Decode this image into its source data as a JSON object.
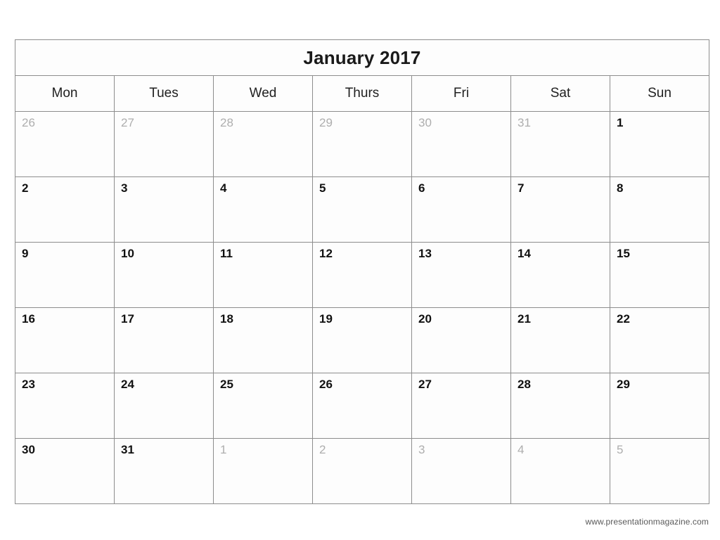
{
  "calendar": {
    "title": "January 2017",
    "weekdays": [
      "Mon",
      "Tues",
      "Wed",
      "Thurs",
      "Fri",
      "Sat",
      "Sun"
    ],
    "weeks": [
      [
        {
          "day": "26",
          "muted": true
        },
        {
          "day": "27",
          "muted": true
        },
        {
          "day": "28",
          "muted": true
        },
        {
          "day": "29",
          "muted": true
        },
        {
          "day": "30",
          "muted": true
        },
        {
          "day": "31",
          "muted": true
        },
        {
          "day": "1",
          "muted": false
        }
      ],
      [
        {
          "day": "2",
          "muted": false
        },
        {
          "day": "3",
          "muted": false
        },
        {
          "day": "4",
          "muted": false
        },
        {
          "day": "5",
          "muted": false
        },
        {
          "day": "6",
          "muted": false
        },
        {
          "day": "7",
          "muted": false
        },
        {
          "day": "8",
          "muted": false
        }
      ],
      [
        {
          "day": "9",
          "muted": false
        },
        {
          "day": "10",
          "muted": false
        },
        {
          "day": "11",
          "muted": false
        },
        {
          "day": "12",
          "muted": false
        },
        {
          "day": "13",
          "muted": false
        },
        {
          "day": "14",
          "muted": false
        },
        {
          "day": "15",
          "muted": false
        }
      ],
      [
        {
          "day": "16",
          "muted": false
        },
        {
          "day": "17",
          "muted": false
        },
        {
          "day": "18",
          "muted": false
        },
        {
          "day": "19",
          "muted": false
        },
        {
          "day": "20",
          "muted": false
        },
        {
          "day": "21",
          "muted": false
        },
        {
          "day": "22",
          "muted": false
        }
      ],
      [
        {
          "day": "23",
          "muted": false
        },
        {
          "day": "24",
          "muted": false
        },
        {
          "day": "25",
          "muted": false
        },
        {
          "day": "26",
          "muted": false
        },
        {
          "day": "27",
          "muted": false
        },
        {
          "day": "28",
          "muted": false
        },
        {
          "day": "29",
          "muted": false
        }
      ],
      [
        {
          "day": "30",
          "muted": false
        },
        {
          "day": "31",
          "muted": false
        },
        {
          "day": "1",
          "muted": true
        },
        {
          "day": "2",
          "muted": true
        },
        {
          "day": "3",
          "muted": true
        },
        {
          "day": "4",
          "muted": true
        },
        {
          "day": "5",
          "muted": true
        }
      ]
    ]
  },
  "footer": {
    "credit": "www.presentationmagazine.com"
  },
  "colors": {
    "grid_border": "#8d8d8d",
    "day_text": "#111111",
    "muted_day_text": "#aeaeae",
    "page_background": "#ffffff",
    "cell_background": "#fdfdfd",
    "footer_text": "#5a5a5a"
  }
}
